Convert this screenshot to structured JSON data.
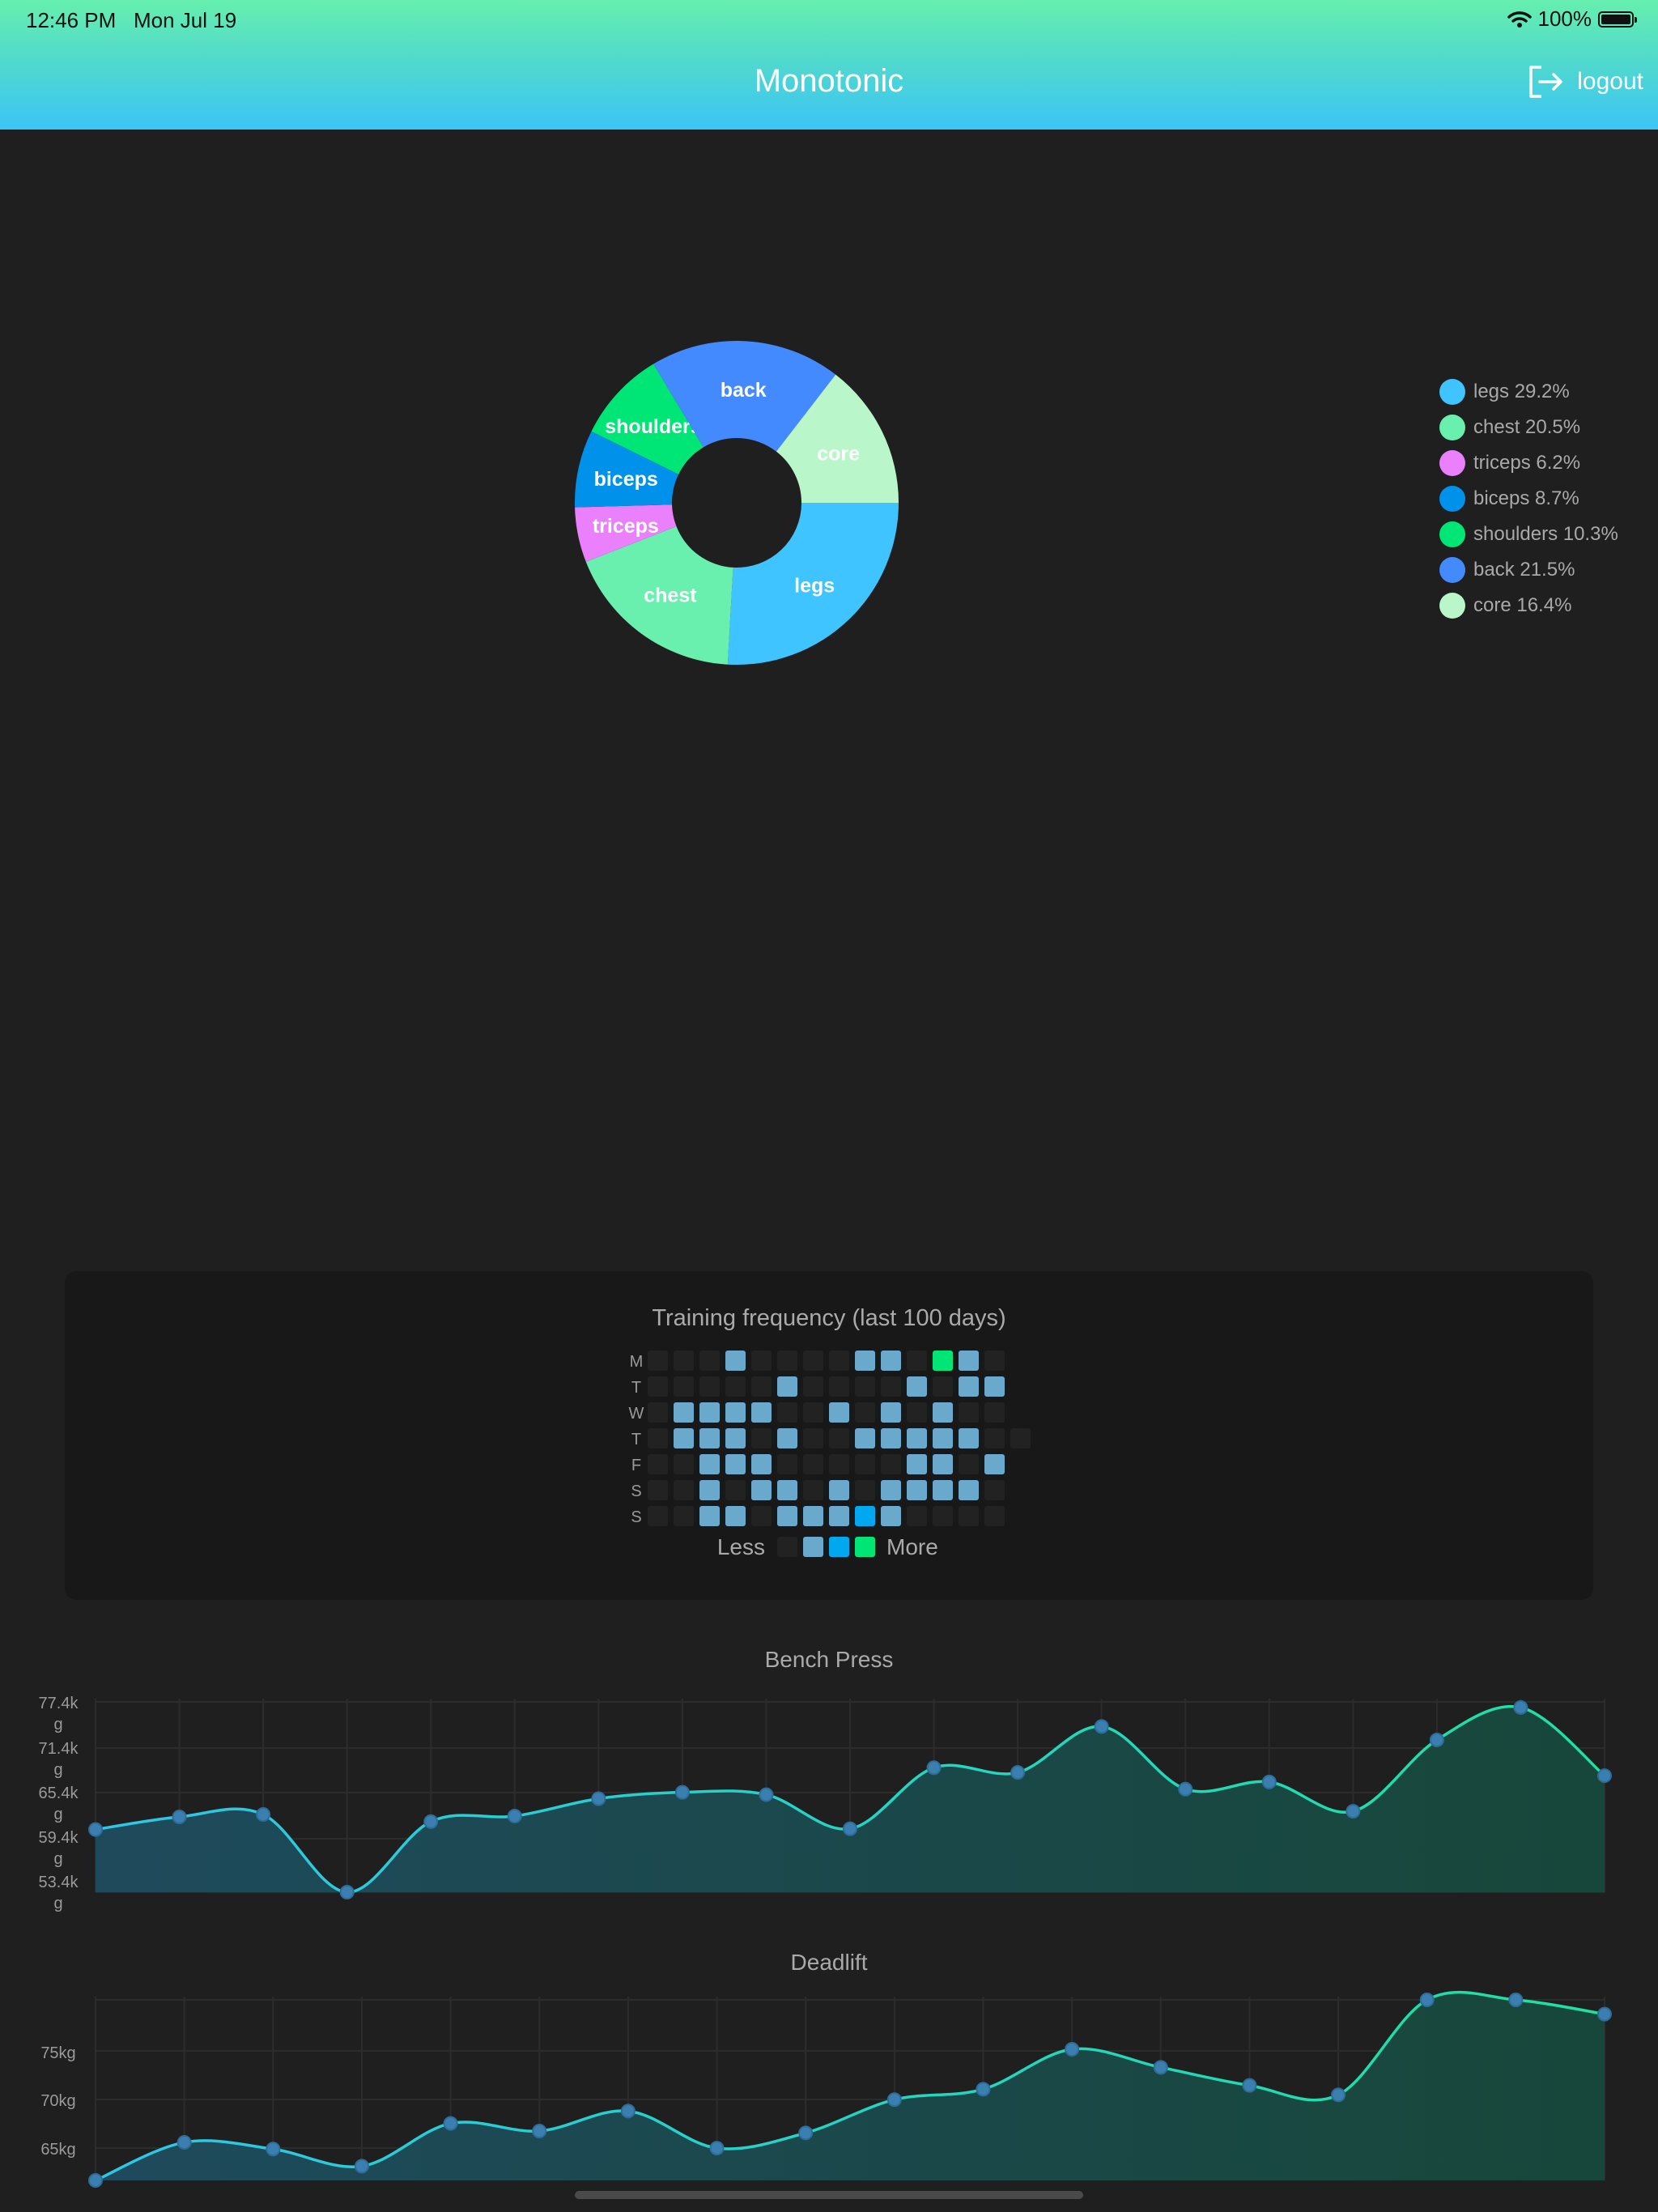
{
  "status": {
    "time": "12:46 PM",
    "date": "Mon Jul 19",
    "battery": "100%"
  },
  "header": {
    "title": "Monotonic",
    "logout_label": "logout"
  },
  "colors": {
    "legs": "#40c4ff",
    "chest": "#69f0ae",
    "triceps": "#ea80fc",
    "biceps": "#0091ea",
    "shoulders": "#00e676",
    "back": "#448aff",
    "core": "#b9f6ca"
  },
  "muscle_chart": {
    "type": "pie",
    "slices": [
      {
        "label": "legs",
        "value": 29.2,
        "legend": "legs 29.2%",
        "color": "#40c4ff"
      },
      {
        "label": "chest",
        "value": 20.5,
        "legend": "chest 20.5%",
        "color": "#69f0ae"
      },
      {
        "label": "triceps",
        "value": 6.2,
        "legend": "triceps 6.2%",
        "color": "#ea80fc"
      },
      {
        "label": "biceps",
        "value": 8.7,
        "legend": "biceps 8.7%",
        "color": "#0091ea"
      },
      {
        "label": "shoulders",
        "value": 10.3,
        "legend": "shoulders 10.3%",
        "color": "#00e676"
      },
      {
        "label": "back",
        "value": 21.5,
        "legend": "back 21.5%",
        "color": "#448aff"
      },
      {
        "label": "core",
        "value": 16.4,
        "legend": "core 16.4%",
        "color": "#b9f6ca"
      }
    ]
  },
  "heatmap": {
    "title": "Training frequency (last 100 days)",
    "day_labels": [
      "M",
      "T",
      "W",
      "T",
      "F",
      "S",
      "S"
    ],
    "legend_less": "Less",
    "legend_more": "More",
    "level_colors": [
      "#222222",
      "#6aa9cc",
      "#00a8f0",
      "#00e676"
    ],
    "rows": [
      [
        0,
        0,
        0,
        1,
        0,
        0,
        0,
        0,
        1,
        1,
        0,
        3,
        1,
        0
      ],
      [
        0,
        0,
        0,
        0,
        0,
        1,
        0,
        0,
        0,
        0,
        1,
        0,
        1,
        1
      ],
      [
        0,
        1,
        1,
        1,
        1,
        0,
        0,
        1,
        0,
        1,
        0,
        1,
        0,
        0
      ],
      [
        0,
        1,
        1,
        1,
        0,
        1,
        0,
        0,
        1,
        1,
        1,
        1,
        1,
        0,
        0
      ],
      [
        0,
        0,
        1,
        1,
        1,
        0,
        0,
        0,
        0,
        0,
        1,
        1,
        0,
        1
      ],
      [
        0,
        0,
        1,
        0,
        1,
        1,
        0,
        1,
        0,
        1,
        1,
        1,
        1,
        0
      ],
      [
        0,
        0,
        1,
        1,
        0,
        1,
        1,
        1,
        2,
        1,
        0,
        0,
        0,
        0
      ]
    ]
  },
  "chart_data": [
    {
      "type": "area",
      "title": "Bench Press",
      "y_ticks": [
        "77.4k g",
        "71.4k g",
        "65.4k g",
        "59.4k g",
        "53.4k g"
      ],
      "ylim": [
        53400,
        77400
      ],
      "values": [
        61300,
        62900,
        63200,
        53400,
        62300,
        63000,
        65200,
        66000,
        65700,
        61400,
        69100,
        68500,
        74300,
        66400,
        67300,
        63600,
        72600,
        76700,
        68100
      ]
    },
    {
      "type": "area",
      "title": "Deadlift",
      "y_ticks": [
        "75kg",
        "70kg",
        "65kg"
      ],
      "ylim": [
        61000,
        80000
      ],
      "values": [
        61000,
        65000,
        64300,
        62500,
        67000,
        66200,
        68300,
        64400,
        66000,
        69500,
        70600,
        74800,
        72900,
        71000,
        70000,
        80000,
        80000,
        78500
      ]
    }
  ]
}
